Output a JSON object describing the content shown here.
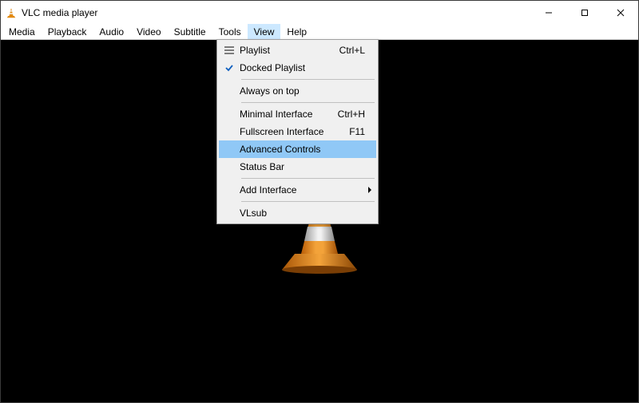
{
  "window": {
    "title": "VLC media player"
  },
  "menubar": {
    "items": [
      {
        "label": "Media"
      },
      {
        "label": "Playback"
      },
      {
        "label": "Audio"
      },
      {
        "label": "Video"
      },
      {
        "label": "Subtitle"
      },
      {
        "label": "Tools"
      },
      {
        "label": "View"
      },
      {
        "label": "Help"
      }
    ],
    "open_index": 6
  },
  "view_menu": {
    "playlist": {
      "label": "Playlist",
      "shortcut": "Ctrl+L"
    },
    "docked_playlist": {
      "label": "Docked Playlist"
    },
    "always_on_top": {
      "label": "Always on top"
    },
    "minimal_interface": {
      "label": "Minimal Interface",
      "shortcut": "Ctrl+H"
    },
    "fullscreen_interface": {
      "label": "Fullscreen Interface",
      "shortcut": "F11"
    },
    "advanced_controls": {
      "label": "Advanced Controls"
    },
    "status_bar": {
      "label": "Status Bar"
    },
    "add_interface": {
      "label": "Add Interface"
    },
    "vlsub": {
      "label": "VLsub"
    }
  }
}
